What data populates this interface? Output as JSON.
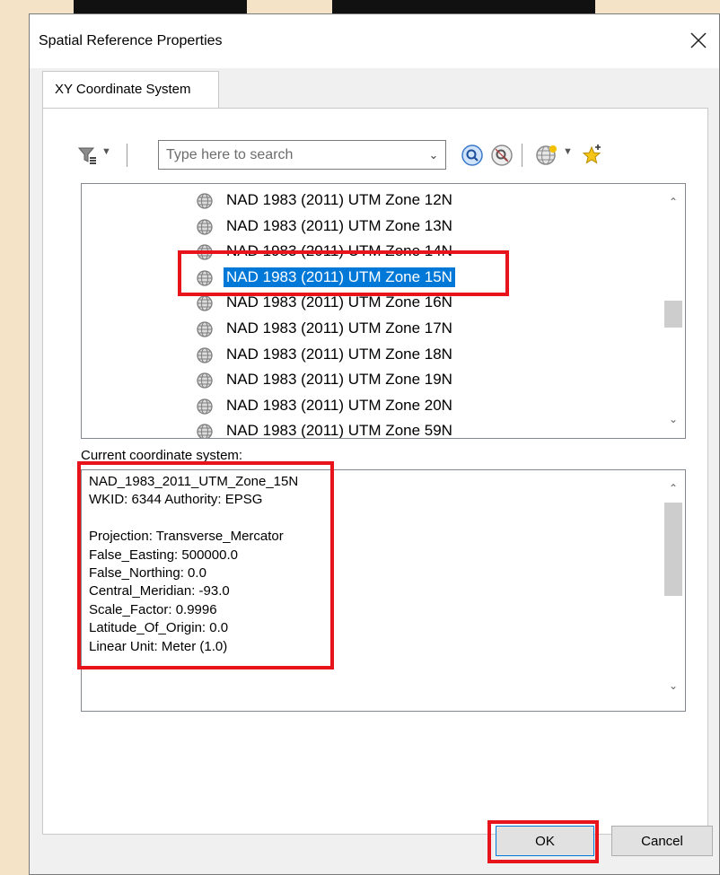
{
  "dialog": {
    "title": "Spatial Reference Properties",
    "close_symbol": "✕",
    "tab_label": "XY Coordinate System"
  },
  "toolbar": {
    "filter_icon": "filter-icon",
    "search_placeholder": "Type here to search",
    "search_value": "",
    "search_dropdown_symbol": "⌄",
    "search_icon": "search-icon",
    "clear_search_icon": "clear-search-icon",
    "globe_add_icon": "globe-dropdown-icon",
    "favorite_icon": "add-favorite-icon"
  },
  "coordinate_list": {
    "items": [
      {
        "label": "NAD 1983 (2011) UTM Zone 12N",
        "selected": false
      },
      {
        "label": "NAD 1983 (2011) UTM Zone 13N",
        "selected": false
      },
      {
        "label": "NAD 1983 (2011) UTM Zone 14N",
        "selected": false
      },
      {
        "label": "NAD 1983 (2011) UTM Zone 15N",
        "selected": true
      },
      {
        "label": "NAD 1983 (2011) UTM Zone 16N",
        "selected": false
      },
      {
        "label": "NAD 1983 (2011) UTM Zone 17N",
        "selected": false
      },
      {
        "label": "NAD 1983 (2011) UTM Zone 18N",
        "selected": false
      },
      {
        "label": "NAD 1983 (2011) UTM Zone 19N",
        "selected": false
      },
      {
        "label": "NAD 1983 (2011) UTM Zone 20N",
        "selected": false
      },
      {
        "label": "NAD 1983 (2011) UTM Zone 59N",
        "selected": false
      }
    ]
  },
  "current": {
    "label": "Current coordinate system:",
    "lines": [
      "NAD_1983_2011_UTM_Zone_15N",
      "WKID: 6344 Authority: EPSG",
      "",
      "Projection: Transverse_Mercator",
      "False_Easting: 500000.0",
      "False_Northing: 0.0",
      "Central_Meridian: -93.0",
      "Scale_Factor: 0.9996",
      "Latitude_Of_Origin: 0.0",
      "Linear Unit: Meter (1.0)"
    ]
  },
  "buttons": {
    "ok": "OK",
    "cancel": "Cancel"
  },
  "colors": {
    "highlight": "#e8141c",
    "selection": "#0078d7",
    "background": "#f5e3c8"
  },
  "scroll_symbols": {
    "up": "⌃",
    "down": "⌄"
  }
}
